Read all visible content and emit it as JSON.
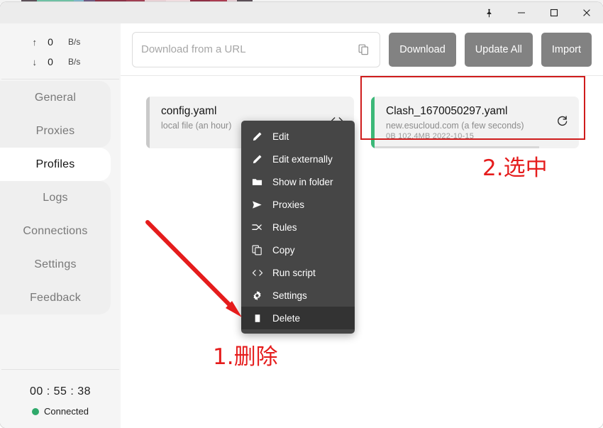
{
  "window": {
    "controls": [
      {
        "name": "pin-button",
        "label": "⚑"
      },
      {
        "name": "minimize-button",
        "label": "–"
      },
      {
        "name": "maximize-button",
        "label": "☐"
      },
      {
        "name": "close-button",
        "label": "✕"
      }
    ],
    "desktop_strip_colors": [
      "#5d5159",
      "#6fc0a4",
      "#7fb4c9",
      "#6e5b82",
      "#8c3347",
      "#a03f52",
      "#e8d0d4",
      "#f0dde0",
      "#8e2f44",
      "#aa3b50",
      "#e3cdd2",
      "#5b4f57"
    ]
  },
  "sidebar": {
    "speed": {
      "upload": {
        "arrow": "↑",
        "value": "0",
        "unit": "B/s"
      },
      "download": {
        "arrow": "↓",
        "value": "0",
        "unit": "B/s"
      }
    },
    "items": [
      {
        "label": "General",
        "active": false
      },
      {
        "label": "Proxies",
        "active": false
      },
      {
        "label": "Profiles",
        "active": true
      },
      {
        "label": "Logs",
        "active": false
      },
      {
        "label": "Connections",
        "active": false
      },
      {
        "label": "Settings",
        "active": false
      },
      {
        "label": "Feedback",
        "active": false
      }
    ],
    "status": {
      "timer": "00 : 55 : 38",
      "connection_label": "Connected",
      "connection_color": "#2fa96b"
    }
  },
  "toolbar": {
    "url_placeholder": "Download from a URL",
    "url_value": "",
    "paste_icon": "copy-icon",
    "download_label": "Download",
    "update_all_label": "Update All",
    "import_label": "Import",
    "button_color": "#828282"
  },
  "profiles": [
    {
      "title": "config.yaml",
      "subtitle": "local file (an hour)",
      "meta": "",
      "action_icon": "code-icon",
      "selected": false,
      "bar_color": "#c9c9c9"
    },
    {
      "title": "Clash_1670050297.yaml",
      "subtitle": "new.esucloud.com (a few seconds)",
      "meta": "0B   102.4MB   2022-10-15",
      "action_icon": "refresh-icon",
      "selected": true,
      "bar_color": "#3cb878"
    }
  ],
  "context_menu": {
    "items": [
      {
        "label": "Edit",
        "icon": "pencil-icon",
        "highlight": false
      },
      {
        "label": "Edit externally",
        "icon": "pencil-icon",
        "highlight": false
      },
      {
        "label": "Show in folder",
        "icon": "folder-icon",
        "highlight": false
      },
      {
        "label": "Proxies",
        "icon": "send-icon",
        "highlight": false
      },
      {
        "label": "Rules",
        "icon": "rules-icon",
        "highlight": false
      },
      {
        "label": "Copy",
        "icon": "copy-icon",
        "highlight": false
      },
      {
        "label": "Run script",
        "icon": "code-icon",
        "highlight": false
      },
      {
        "label": "Settings",
        "icon": "gear-icon",
        "highlight": false
      },
      {
        "label": "Delete",
        "icon": "trash-icon",
        "highlight": true
      }
    ]
  },
  "annotations": {
    "color": "#e51c1c",
    "step1_label": "1.删除",
    "step2_label": "2.选中",
    "arrow_from": "208,313",
    "arrow_to": "337,443"
  }
}
